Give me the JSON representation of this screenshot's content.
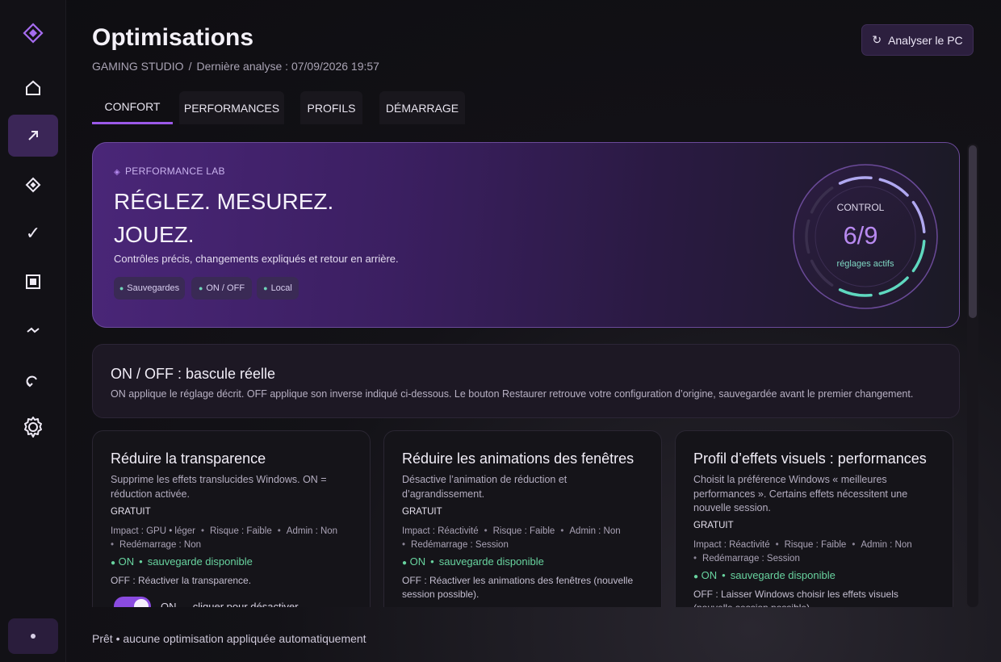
{
  "app": {
    "title": "Optimisations",
    "breadcrumb": {
      "studio": "GAMING STUDIO",
      "separator": "/",
      "last_scan": "Dernière analyse : 07/09/2026 19:57"
    },
    "analyze_button": {
      "icon": "refresh-icon",
      "label": "Analyser le PC"
    }
  },
  "sidebar": {
    "logo": "diamond-logo",
    "items": [
      {
        "name": "home-icon",
        "glyph": "⌂"
      },
      {
        "name": "optimize-icon",
        "glyph": "↗",
        "active": true
      },
      {
        "name": "diamond-icon",
        "glyph": "◈"
      },
      {
        "name": "check-icon",
        "glyph": "✓"
      },
      {
        "name": "square-icon",
        "glyph": "▣"
      },
      {
        "name": "pulse-icon",
        "glyph": "⌁"
      },
      {
        "name": "undo-icon",
        "glyph": "↶"
      },
      {
        "name": "gear-icon",
        "glyph": "⚙"
      }
    ]
  },
  "tabs": [
    {
      "label": "CONFORT",
      "active": true
    },
    {
      "label": "PERFORMANCES"
    },
    {
      "label": "PROFILS"
    },
    {
      "label": "DÉMARRAGE"
    }
  ],
  "hero": {
    "kicker": "PERFORMANCE LAB",
    "headline_line1": "RÉGLEZ. MESUREZ.",
    "headline_line2": "JOUEZ.",
    "description": "Contrôles précis, changements expliqués et retour en arrière.",
    "pills": [
      "Sauvegardes",
      "ON / OFF",
      "Local"
    ],
    "gauge": {
      "label": "CONTROL",
      "value": "6/9",
      "sub": "réglages actifs",
      "active": 6,
      "total": 9
    }
  },
  "info": {
    "title": "ON / OFF : bascule réelle",
    "text": "ON applique le réglage décrit. OFF applique son inverse indiqué ci-dessous. Le bouton Restaurer retrouve votre configuration d’origine, sauvegardée avant le premier changement."
  },
  "cards": [
    {
      "title": "Réduire la transparence",
      "description": "Supprime les effets translucides Windows. ON = réduction activée.",
      "tier": "GRATUIT",
      "meta": [
        "Impact : GPU • léger",
        "Risque : Faible",
        "Admin : Non",
        "Redémarrage : Non"
      ],
      "status_on": "ON",
      "status_backup": "sauvegarde disponible",
      "off_text": "OFF : Réactiver la transparence.",
      "toggle_label": "ON — cliquer pour désactiver"
    },
    {
      "title": "Réduire les animations des fenêtres",
      "description": "Désactive l’animation de réduction et d’agrandissement.",
      "tier": "GRATUIT",
      "meta": [
        "Impact : Réactivité",
        "Risque : Faible",
        "Admin : Non",
        "Redémarrage : Session"
      ],
      "status_on": "ON",
      "status_backup": "sauvegarde disponible",
      "off_text": "OFF : Réactiver les animations des fenêtres (nouvelle session possible)."
    },
    {
      "title": "Profil d’effets visuels : performances",
      "description": "Choisit la préférence Windows « meilleures performances ». Certains effets nécessitent une nouvelle session.",
      "tier": "GRATUIT",
      "meta": [
        "Impact : Réactivité",
        "Risque : Faible",
        "Admin : Non",
        "Redémarrage : Session"
      ],
      "status_on": "ON",
      "status_backup": "sauvegarde disponible",
      "off_text": "OFF : Laisser Windows choisir les effets visuels (nouvelle session possible)."
    }
  ],
  "footer": {
    "status": "Prêt • aucune optimisation appliquée automatiquement"
  },
  "colors": {
    "accent": "#9b59e8",
    "ok": "#68d39f",
    "teal": "#7fd7c3"
  }
}
